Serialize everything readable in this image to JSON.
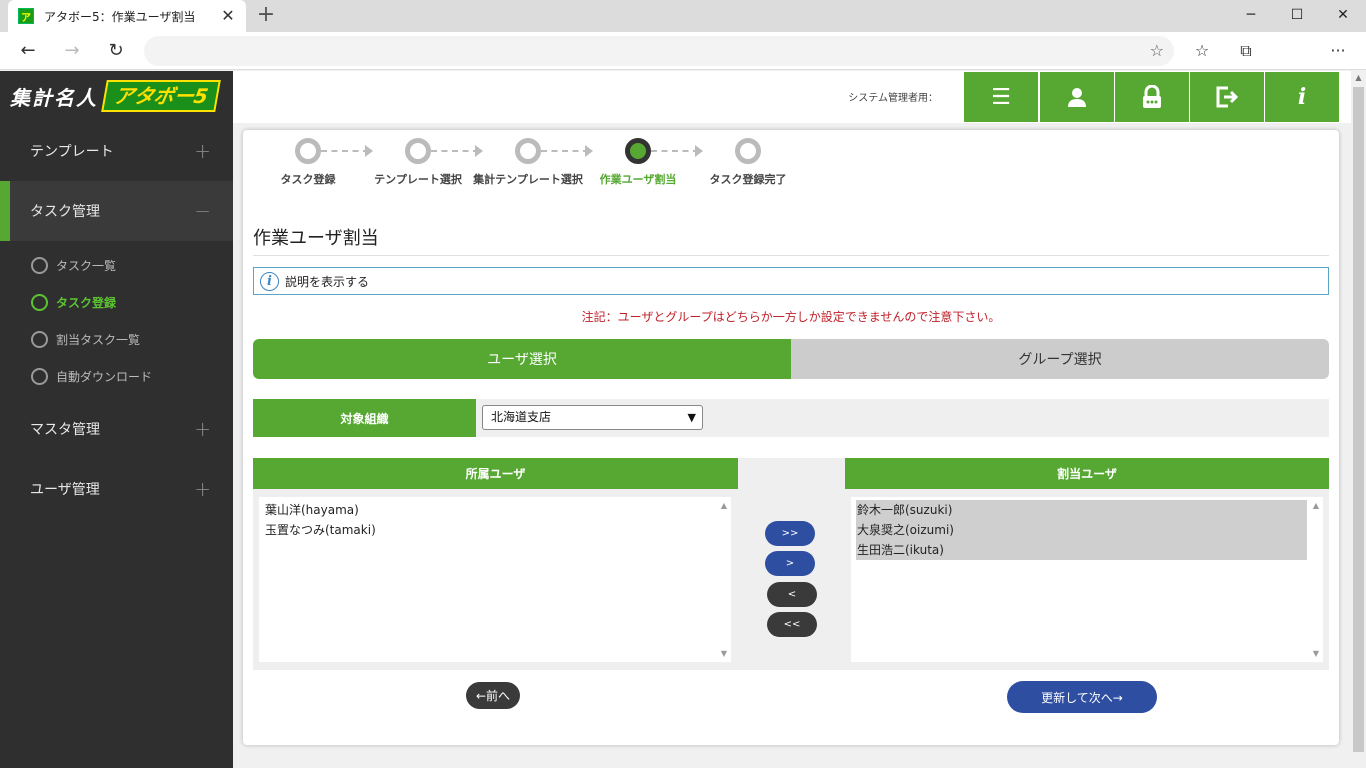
{
  "browser": {
    "tab_title": "アタボー5：作業ユーザ割当",
    "tab_favicon": "ア",
    "close": "✕",
    "new_tab": "+",
    "minimize": "─",
    "maximize": "☐",
    "window_close": "✕",
    "back": "←",
    "forward": "→",
    "reload": "↻",
    "favorite_add": "☆",
    "favorites": "☆",
    "collections": "⧉",
    "more": "···"
  },
  "sidebar": {
    "logo_text": "集計名人",
    "logo_badge": "アタボー5",
    "menus": [
      {
        "label": "テンプレート",
        "toggle": "+"
      },
      {
        "label": "タスク管理",
        "toggle": "−"
      },
      {
        "label": "マスタ管理",
        "toggle": "+"
      },
      {
        "label": "ユーザ管理",
        "toggle": "+"
      }
    ],
    "task_submenu": [
      "タスク一覧",
      "タスク登録",
      "割当タスク一覧",
      "自動ダウンロード"
    ]
  },
  "header": {
    "admin_label": "システム管理者用：",
    "buttons": [
      {
        "icon": "list-icon",
        "glyph": "☰"
      },
      {
        "icon": "user-icon",
        "glyph": "●"
      },
      {
        "icon": "lock-icon",
        "glyph": "🔒"
      },
      {
        "icon": "logout-icon",
        "glyph": "⇥"
      },
      {
        "icon": "info-icon",
        "glyph": "i"
      }
    ]
  },
  "steps": [
    "タスク登録",
    "テンプレート選択",
    "集計テンプレート選択",
    "作業ユーザ割当",
    "タスク登録完了"
  ],
  "page": {
    "title": "作業ユーザ割当",
    "info_text": "説明を表示する",
    "note": "注記：ユーザとグループはどちらか一方しか設定できませんので注意下さい。",
    "tab_user": "ユーザ選択",
    "tab_group": "グループ選択",
    "org_label": "対象組織",
    "org_selected": "北海道支店",
    "left_header": "所属ユーザ",
    "right_header": "割当ユーザ",
    "left_users": [
      "葉山洋(hayama)",
      "玉置なつみ(tamaki)"
    ],
    "right_users": [
      "鈴木一郎(suzuki)",
      "大泉奨之(oizumi)",
      "生田浩二(ikuta)"
    ],
    "btn_all_right": ">>",
    "btn_right": ">",
    "btn_left": "<",
    "btn_all_left": "<<",
    "prev": "←前へ",
    "next": "更新して次へ→"
  },
  "colors": {
    "accent_green": "#56a832",
    "dark_sidebar": "#2f2f2f",
    "blue_button": "#2e4ea2",
    "note_red": "#c0202a"
  }
}
